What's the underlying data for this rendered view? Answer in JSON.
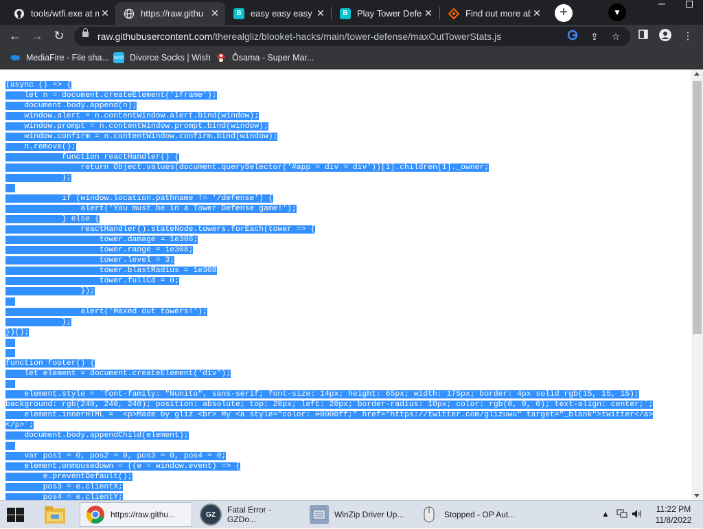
{
  "browser": {
    "tabs": [
      {
        "title": "tools/wtfi.exe at m",
        "icon": "github-icon"
      },
      {
        "title": "https://raw.githu",
        "icon": "globe-icon"
      },
      {
        "title": "easy easy easy ea",
        "icon": "blooket-icon"
      },
      {
        "title": "Play Tower Defens",
        "icon": "blooket-icon"
      },
      {
        "title": "Find out more ab",
        "icon": "sourceforge-icon"
      }
    ],
    "new_tab": "+",
    "url_host": "raw.githubusercontent.com",
    "url_path": "/therealgliz/blooket-hacks/main/tower-defense/maxOutTowerStats.js",
    "bookmarks": [
      {
        "label": "MediaFire - File sha...",
        "icon": "mediafire-icon"
      },
      {
        "label": "Divorce Socks | Wish",
        "icon": "wish-icon"
      },
      {
        "label": "Ôsama - Super Mar...",
        "icon": "mushroom-icon"
      }
    ]
  },
  "code_lines": [
    "(async () => {",
    "    let n = document.createElement('iframe');",
    "    document.body.append(n);",
    "    window.alert = n.contentWindow.alert.bind(window);",
    "    window.prompt = n.contentWindow.prompt.bind(window);",
    "    window.confirm = n.contentWindow.confirm.bind(window);",
    "    n.remove();",
    "            function reactHandler() {",
    "                return Object.values(document.querySelector('#app > div > div'))[1].children[1]._owner;",
    "            };",
    "",
    "            if (window.location.pathname != '/defense') {",
    "                alert('You must be in a Tower Defense game!');",
    "            } else {",
    "                reactHandler().stateNode.towers.forEach(tower => {",
    "                    tower.damage = 1e308;",
    "                    tower.range = 1e308;",
    "                    tower.level = 3;",
    "                    tower.blastRadius = 1e308",
    "                    tower.fullCd = 0;",
    "                });",
    "",
    "                alert('Maxed out towers!');",
    "            };",
    "})();",
    "",
    "",
    "function footer() {",
    "    let element = document.createElement('div');",
    "",
    "    element.style = `font-family: \"Nunito\", sans-serif; font-size: 14px; height: 65px; width: 175px; border: 4px solid rgb(15, 15, 15);",
    "background: rgb(240, 240, 240); position: absolute; top: 20px; left: 20px; border-radius: 10px; color: rgb(0, 0, 0); text-align: center;`;",
    "    element.innerHTML = `<p>Made by gliz <br> My <a style=\"color: #0000ff;\" href=\"https://twitter.com/glizuwu\" target=\"_blank\">twitter</a>",
    "</p>`;",
    "    document.body.appendChild(element);",
    "",
    "    var pos1 = 0, pos2 = 0, pos3 = 0, pos4 = 0;",
    "    element.onmousedown = ((e = window.event) => {",
    "        e.preventDefault();",
    "        pos3 = e.clientX;",
    "        pos4 = e.clientY;"
  ],
  "taskbar": {
    "tasks": [
      {
        "label": "https://raw.githu...",
        "icon": "chrome-icon",
        "active": true
      },
      {
        "label": "Fatal Error - GZDo...",
        "icon": "gzdoom-icon",
        "active": false
      },
      {
        "label": "WinZip Driver Up...",
        "icon": "winzip-icon",
        "active": false
      },
      {
        "label": "Stopped - OP Aut...",
        "icon": "mouse-icon",
        "active": false
      }
    ],
    "time": "11:22 PM",
    "date": "11/8/2022"
  },
  "colors": {
    "selection": "#3390ff",
    "tabstrip": "#202124",
    "toolbar": "#35363a",
    "taskbar": "#dbe1ea"
  }
}
